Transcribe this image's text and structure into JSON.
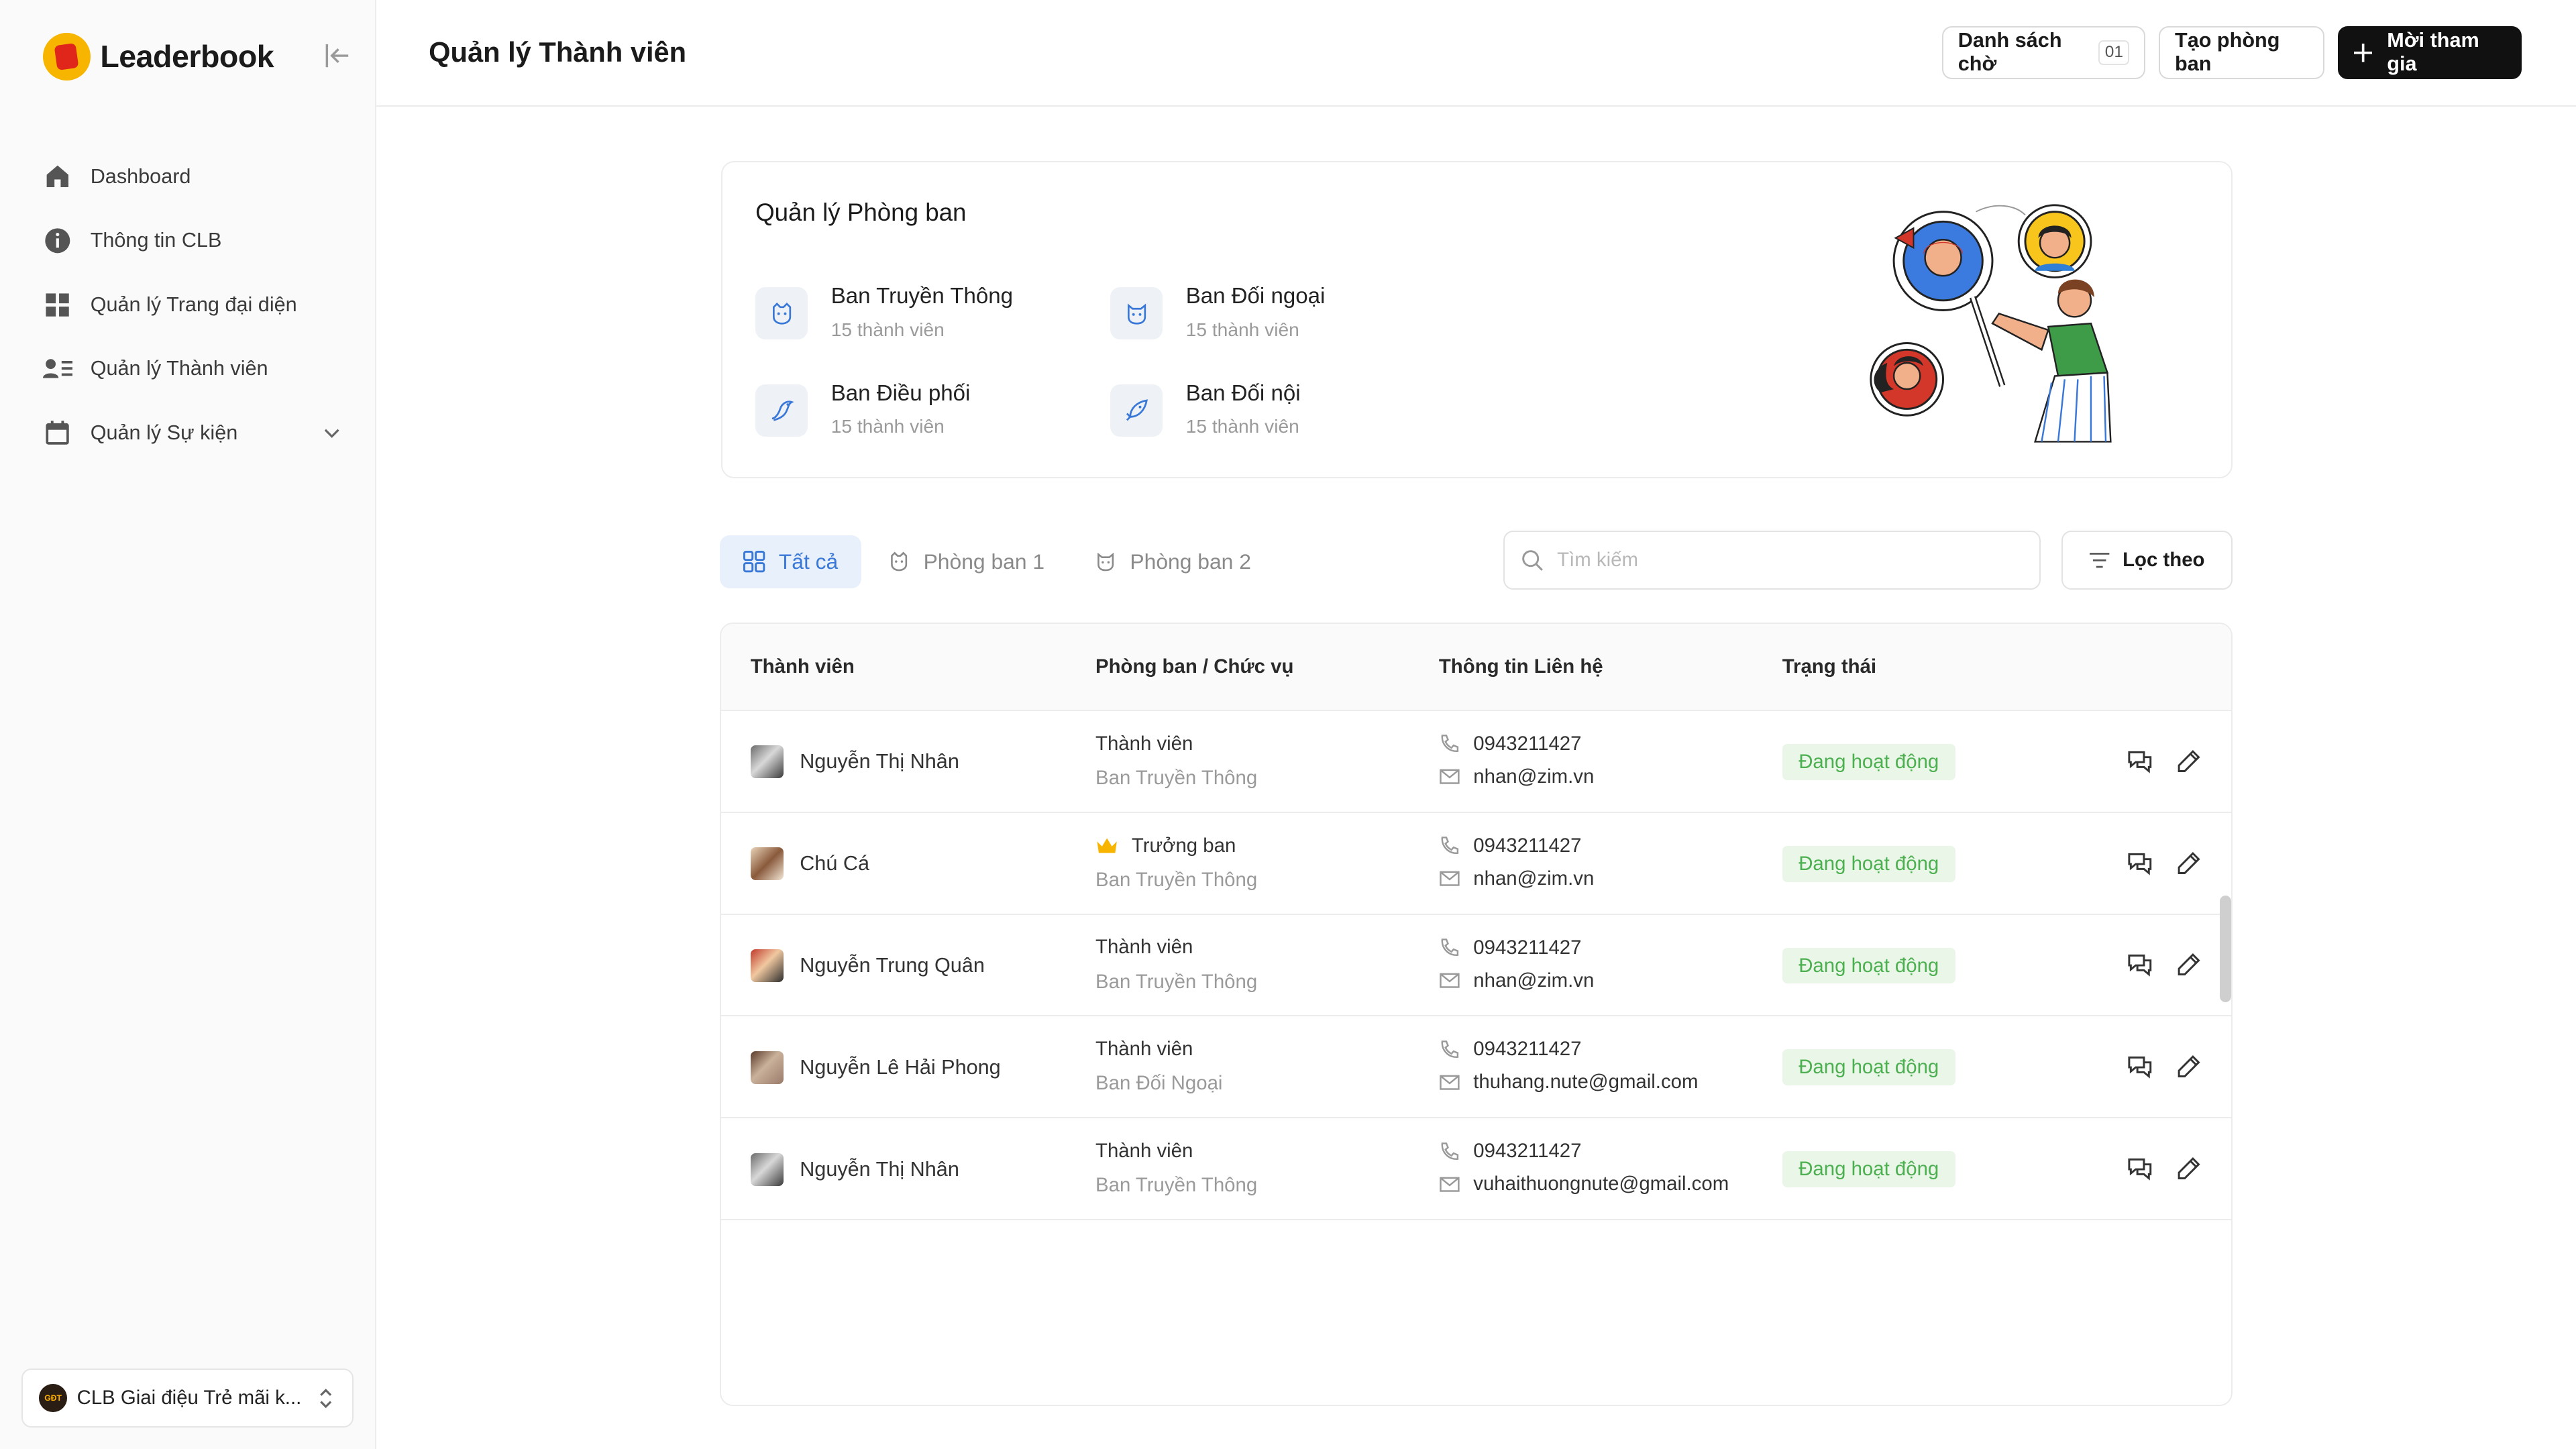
{
  "app": {
    "brand_name": "Leaderbook"
  },
  "sidebar": {
    "items": [
      {
        "label": "Dashboard",
        "icon": "home-icon"
      },
      {
        "label": "Thông tin CLB",
        "icon": "info-icon"
      },
      {
        "label": "Quản lý Trang đại diện",
        "icon": "grid-icon"
      },
      {
        "label": "Quản lý Thành viên",
        "icon": "members-icon"
      },
      {
        "label": "Quản lý Sự kiện",
        "icon": "calendar-icon"
      }
    ],
    "club_name": "CLB Giai điệu Trẻ mãi k..."
  },
  "header": {
    "title": "Quản lý Thành viên",
    "waitlist_label": "Danh sách chờ",
    "waitlist_count": "01",
    "create_label": "Tạo phòng ban",
    "invite_label": "Mời tham gia"
  },
  "departments": {
    "title": "Quản lý Phòng ban",
    "items": [
      {
        "name": "Ban Truyền Thông",
        "count": "15 thành viên",
        "icon": "dog-icon"
      },
      {
        "name": "Ban Đối ngoại",
        "count": "15 thành viên",
        "icon": "cat-icon"
      },
      {
        "name": "Ban Điều phối",
        "count": "15 thành viên",
        "icon": "bird-icon"
      },
      {
        "name": "Ban Đối nội",
        "count": "15 thành viên",
        "icon": "fish-icon"
      }
    ]
  },
  "tabs": [
    {
      "label": "Tất cả",
      "icon": "grid-icon",
      "active": true
    },
    {
      "label": "Phòng ban 1",
      "icon": "dog-icon",
      "active": false
    },
    {
      "label": "Phòng ban 2",
      "icon": "cat-icon",
      "active": false
    }
  ],
  "search": {
    "placeholder": "Tìm kiếm"
  },
  "filter": {
    "label": "Lọc theo"
  },
  "table": {
    "columns": [
      "Thành viên",
      "Phòng ban / Chức vụ",
      "Thông tin Liên hệ",
      "Trạng thái"
    ],
    "rows": [
      {
        "name": "Nguyễn Thị Nhân",
        "role": "Thành viên",
        "department": "Ban Truyền Thông",
        "phone": "0943211427",
        "email": "nhan@zim.vn",
        "status": "Đang hoạt động",
        "leader": false
      },
      {
        "name": "Chú Cá",
        "role": "Trưởng ban",
        "department": "Ban Truyền Thông",
        "phone": "0943211427",
        "email": "nhan@zim.vn",
        "status": "Đang hoạt động",
        "leader": true
      },
      {
        "name": "Nguyễn Trung Quân",
        "role": "Thành viên",
        "department": "Ban Truyền Thông",
        "phone": "0943211427",
        "email": "nhan@zim.vn",
        "status": "Đang hoạt động",
        "leader": false
      },
      {
        "name": "Nguyễn Lê Hải Phong",
        "role": "Thành viên",
        "department": "Ban Đối Ngoại",
        "phone": "0943211427",
        "email": "thuhang.nute@gmail.com",
        "status": "Đang hoạt động",
        "leader": false
      },
      {
        "name": "Nguyễn Thị Nhân",
        "role": "Thành viên",
        "department": "Ban Truyền Thông",
        "phone": "0943211427",
        "email": "vuhaithuongnute@gmail.com",
        "status": "Đang hoạt động",
        "leader": false
      }
    ]
  },
  "colors": {
    "accent": "#3a78d8",
    "tab_active_bg": "#e8f0fb",
    "status_green": "#4caf50",
    "status_bg": "#eaf6e8",
    "brand_yellow": "#f7b500",
    "brand_red": "#e0251b",
    "primary_button": "#111111"
  }
}
